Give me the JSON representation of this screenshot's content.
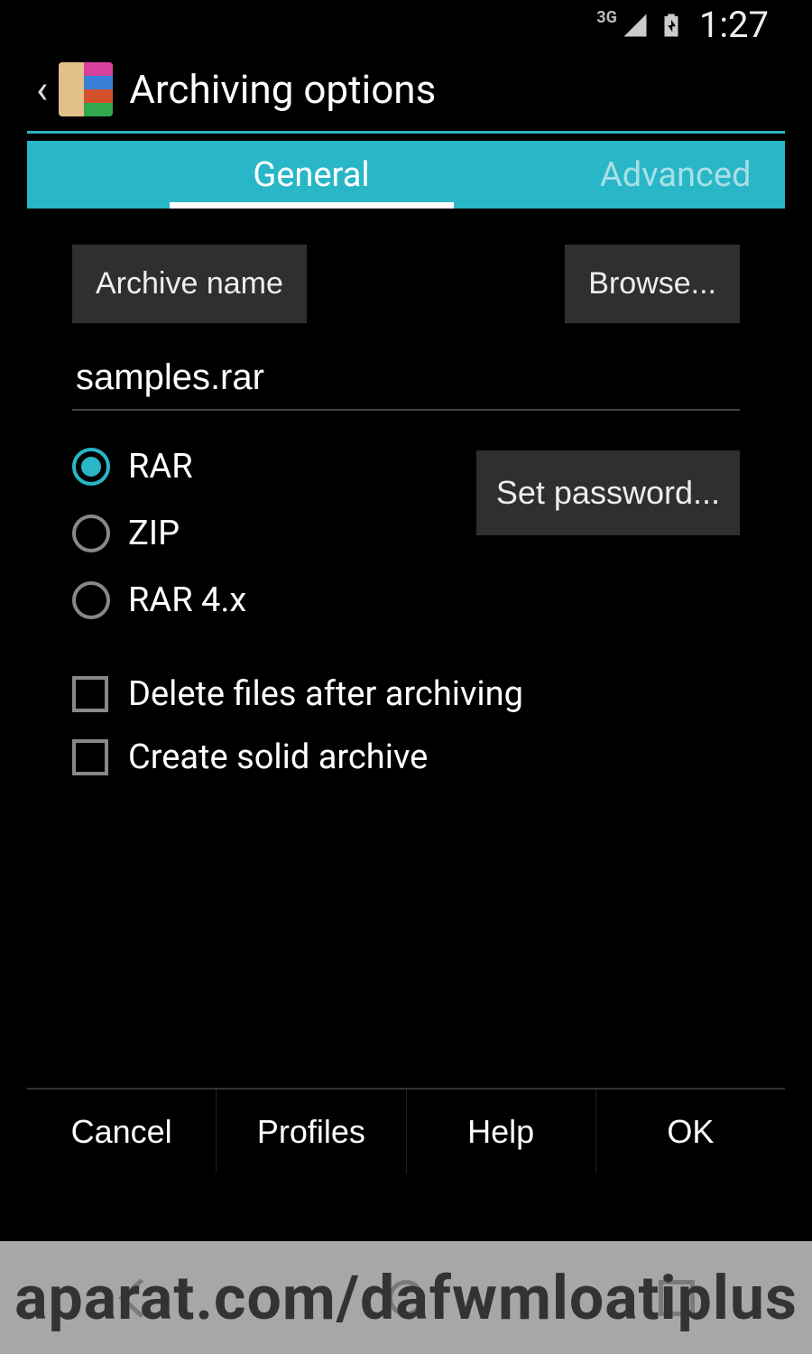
{
  "status": {
    "network_label": "3G",
    "time": "1:27"
  },
  "header": {
    "title": "Archiving options"
  },
  "tabs": {
    "general": "General",
    "advanced": "Advanced"
  },
  "form": {
    "archive_name_label": "Archive name",
    "browse_label": "Browse...",
    "archive_name_value": "samples.rar",
    "formats": {
      "rar": "RAR",
      "zip": "ZIP",
      "rar4x": "RAR 4.x"
    },
    "set_password_label": "Set password...",
    "checks": {
      "delete_after": "Delete files after archiving",
      "solid_archive": "Create solid archive"
    }
  },
  "footer": {
    "cancel": "Cancel",
    "profiles": "Profiles",
    "help": "Help",
    "ok": "OK"
  },
  "watermark": "aparat.com/dafwmloatiplus"
}
